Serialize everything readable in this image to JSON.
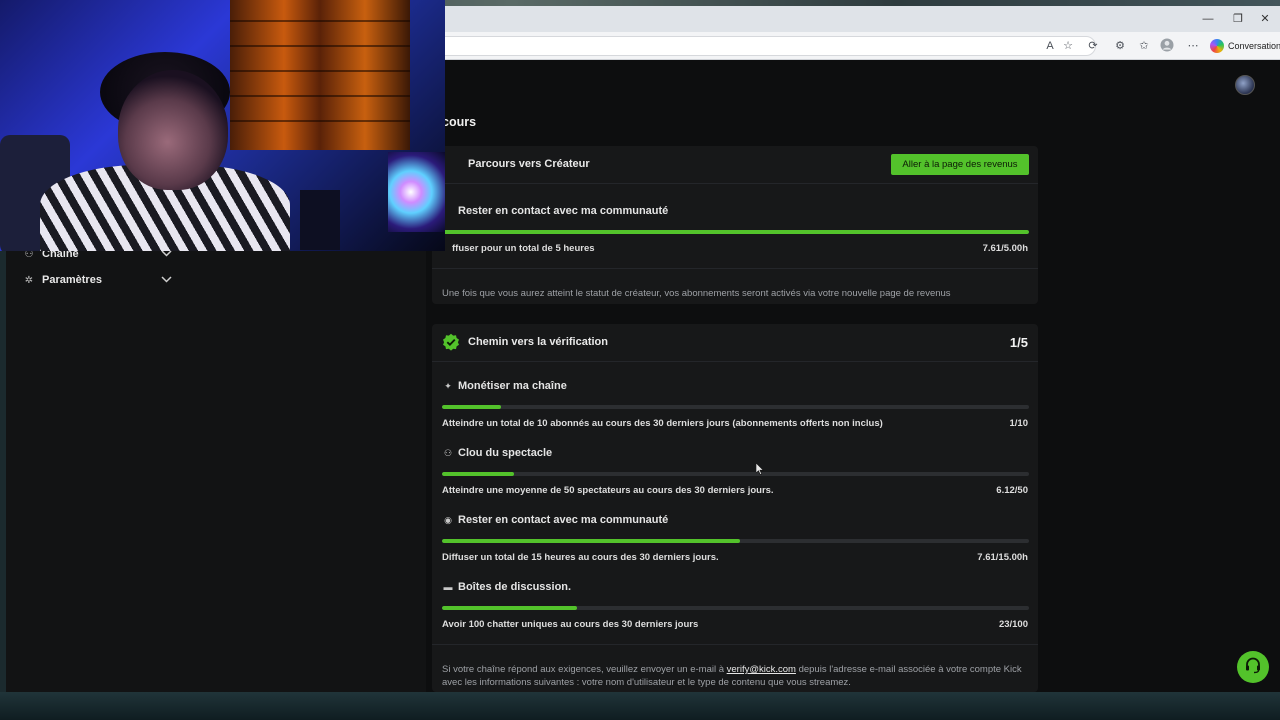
{
  "browser": {
    "conversation_label": "Conversation",
    "minimize_glyph": "—",
    "restore_glyph": "❐",
    "close_glyph": "✕"
  },
  "sidebar": {
    "items": [
      {
        "label": "Chaîne",
        "icon": "users-icon"
      },
      {
        "label": "Paramètres",
        "icon": "gear-icon"
      }
    ]
  },
  "page": {
    "title": "cours"
  },
  "creator_card": {
    "title": "Parcours vers Créateur",
    "revenue_button": "Aller à la page des revenus",
    "requirement": {
      "title": "Rester en contact avec ma communauté",
      "description": "ffuser pour un total de 5 heures",
      "value": "7.61/5.00h",
      "progress": 1.0
    },
    "note": "Une fois que vous aurez atteint le statut de créateur, vos abonnements seront activés via votre nouvelle page de revenus"
  },
  "verification_card": {
    "title": "Chemin vers la vérification",
    "step_count": "1/5",
    "requirements": [
      {
        "title": "Monétiser ma chaîne",
        "icon": "sparkle-icon",
        "description": "Atteindre un total de 10 abonnés au cours des 30 derniers jours (abonnements offerts non inclus)",
        "value": "1/10",
        "progress": 0.1
      },
      {
        "title": "Clou du spectacle",
        "icon": "viewers-icon",
        "description": "Atteindre une moyenne de 50 spectateurs au cours des 30 derniers jours.",
        "value": "6.12/50",
        "progress": 0.1224
      },
      {
        "title": "Rester en contact avec ma communauté",
        "icon": "broadcast-icon",
        "description": "Diffuser un total de 15 heures au cours des 30 derniers jours.",
        "value": "7.61/15.00h",
        "progress": 0.5073
      },
      {
        "title": "Boîtes de discussion.",
        "icon": "chat-icon",
        "description": "Avoir 100 chatter uniques au cours des 30 derniers jours",
        "value": "23/100",
        "progress": 0.23
      }
    ],
    "note_before": "Si votre chaîne répond aux exigences, veuillez envoyer un e-mail à ",
    "note_email": "verify@kick.com",
    "note_after": " depuis l'adresse e-mail associée à votre compte Kick avec les informations suivantes : votre nom d'utilisateur et le type de contenu que vous streamez."
  },
  "colors": {
    "accent": "#53c22b",
    "background": "#0d0e0f",
    "card": "#171819"
  }
}
